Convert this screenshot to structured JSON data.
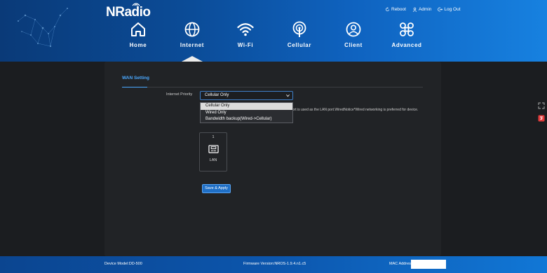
{
  "brand": {
    "logo_text": "NRadio"
  },
  "top_actions": [
    {
      "label": "Reboot",
      "icon": "reboot-icon"
    },
    {
      "label": "Admin",
      "icon": "user-icon"
    },
    {
      "label": "Log Out",
      "icon": "logout-icon"
    }
  ],
  "nav": {
    "active": "Internet",
    "items": [
      {
        "label": "Home",
        "icon": "home-icon"
      },
      {
        "label": "Internet",
        "icon": "globe-icon"
      },
      {
        "label": "Wi-Fi",
        "icon": "wifi-icon"
      },
      {
        "label": "Cellular",
        "icon": "cellular-icon"
      },
      {
        "label": "Client",
        "icon": "client-icon"
      },
      {
        "label": "Advanced",
        "icon": "advanced-icon"
      }
    ]
  },
  "wan": {
    "tab_label": "WAN Setting",
    "priority_label": "Internet Priority",
    "selected_value": "Cellular Only",
    "options": [
      "Cellular Only",
      "Wired Only",
      "Bandwidth backup(Wired->Cellular)"
    ],
    "notice": "port is used as the LAN port.WiredNotice*Wired networking is preferred for device.",
    "port": {
      "number": "1",
      "name": "LAN",
      "icon": "ethernet-port-icon"
    },
    "save_label": "Save & Apply"
  },
  "footer": {
    "device_model": "Device Model:DD-500",
    "firmware": "Firmware Version:NROS-1.9.4.n1.c5",
    "mac_label": "MAC Address:"
  },
  "colors": {
    "header_start": "#0a3a78",
    "header_end": "#1781e0",
    "accent": "#4aa8ff",
    "panel": "#212326",
    "background": "#1b1d20"
  }
}
